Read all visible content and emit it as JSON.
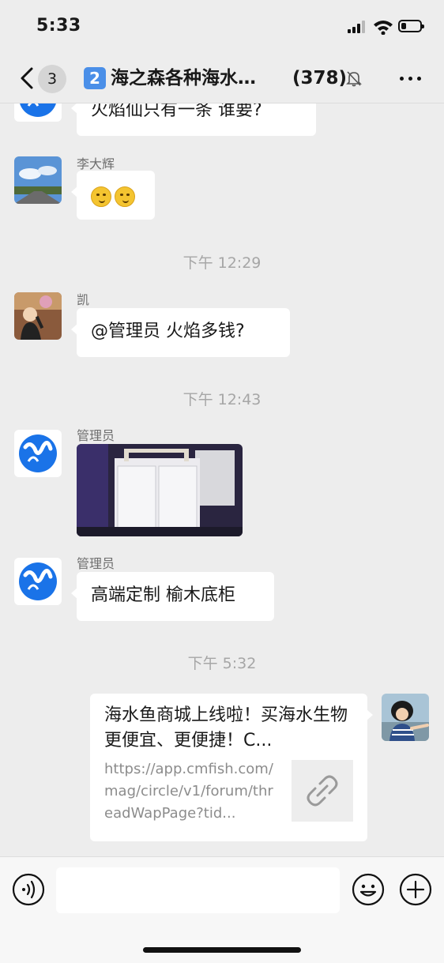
{
  "status_bar": {
    "time": "5:33"
  },
  "header": {
    "back_badge": "3",
    "group_icon": "2",
    "title": "海之森各种海水…",
    "member_count": "(378)",
    "icons": [
      "chevron-left-icon",
      "mute-bell-icon",
      "more-icon"
    ]
  },
  "messages": [
    {
      "type": "text",
      "side": "left",
      "sender": "",
      "avatar": "brand-logo-avatar",
      "text": "火焰仙只有一条  谁要?"
    },
    {
      "type": "emoji",
      "side": "left",
      "sender": "李大辉",
      "avatar": "landscape-photo-avatar",
      "emojis": [
        "thinking-face-emoji",
        "thinking-face-emoji"
      ]
    },
    {
      "type": "timestamp",
      "text": "下午 12:29"
    },
    {
      "type": "text",
      "side": "left",
      "sender": "凯",
      "avatar": "person-photo-avatar",
      "text": "@管理员 火焰多钱?"
    },
    {
      "type": "timestamp",
      "text": "下午 12:43"
    },
    {
      "type": "image",
      "side": "left",
      "sender": "管理员",
      "avatar": "brand-logo-avatar",
      "image": "white-cabinet-photo"
    },
    {
      "type": "text",
      "side": "left",
      "sender": "管理员",
      "avatar": "brand-logo-avatar",
      "text": "高端定制 榆木底柜"
    },
    {
      "type": "timestamp",
      "text": "下午 5:32"
    },
    {
      "type": "link",
      "side": "right",
      "avatar": "child-photo-avatar",
      "title": "海水鱼商城上线啦！买海水生物更便宜、更便捷！C...",
      "description": "https://app.cmfish.com/mag/circle/v1/forum/threadWapPage?tid...",
      "thumbnail": "link-icon"
    }
  ],
  "input_bar": {
    "placeholder": "",
    "icons": [
      "voice-icon",
      "emoji-icon",
      "plus-icon"
    ]
  },
  "colors": {
    "background": "#ededed",
    "bubble_other": "#ffffff",
    "timestamp": "#a6a6a6",
    "brand_blue": "#1a73e8"
  }
}
